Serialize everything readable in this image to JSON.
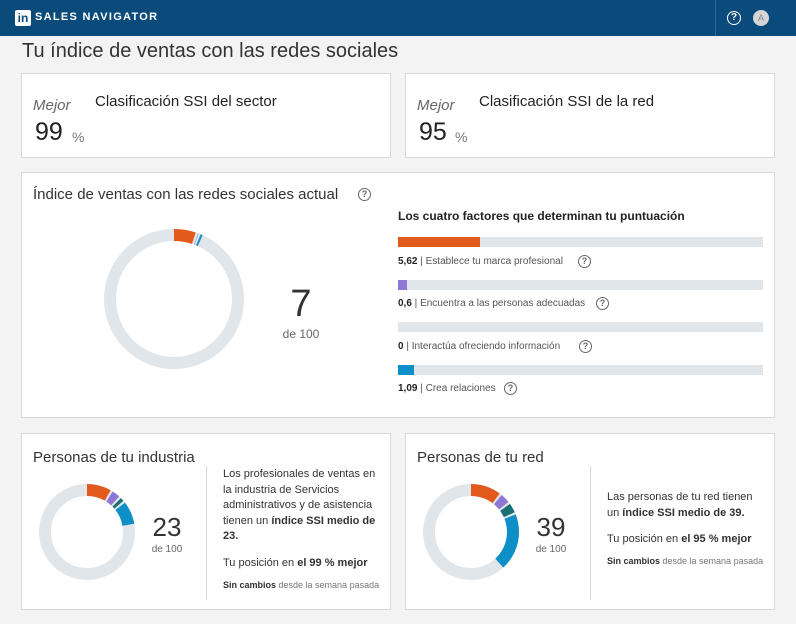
{
  "header": {
    "logo_text": "in",
    "brand": "SALES NAVIGATOR",
    "help_icon": "question-circle-icon",
    "avatar_initial": "A"
  },
  "page_title": "Tu índice de ventas con las redes sociales",
  "rankings": [
    {
      "label": "Mejor",
      "value": "99",
      "unit": "%",
      "title": "Clasificación SSI del sector"
    },
    {
      "label": "Mejor",
      "value": "95",
      "unit": "%",
      "title": "Clasificación SSI de la red"
    }
  ],
  "ssi": {
    "title": "Índice de ventas con las redes sociales actual",
    "score": "7",
    "score_sub": "de 100",
    "factors_title": "Los cuatro factores que determinan tu puntuación",
    "factor_max": 25,
    "factors": [
      {
        "value": "5,62",
        "label": "Establece tu marca profesional",
        "number": 5.62,
        "color": "#e2591c"
      },
      {
        "value": "0,6",
        "label": "Encuentra a las personas adecuadas",
        "number": 0.6,
        "color": "#8f77d6"
      },
      {
        "value": "0",
        "label": "Interactúa ofreciendo información",
        "number": 0,
        "color": "#1b6f73"
      },
      {
        "value": "1,09",
        "label": "Crea relaciones",
        "number": 1.09,
        "color": "#0d8fc7"
      }
    ]
  },
  "groups": [
    {
      "title": "Personas de tu industria",
      "score": "23",
      "score_sub": "de 100",
      "description": "Los profesionales de ventas en la industria de Servicios administrativos y de asistencia tienen un ",
      "description_bold": "índice SSI medio de 23.",
      "position_prefix": "Tu posición en ",
      "position_bold": "el 99 % mejor",
      "change_bold": "Sin cambios",
      "change_rest": " desde la semana pasada",
      "segments": [
        {
          "value": 9,
          "color": "#e2591c"
        },
        {
          "value": 3.5,
          "color": "#8f77d6"
        },
        {
          "value": 2,
          "color": "#1b6f73"
        },
        {
          "value": 8.5,
          "color": "#0d8fc7"
        }
      ]
    },
    {
      "title": "Personas de tu red",
      "score": "39",
      "score_sub": "de 100",
      "description": "Las personas de tu red tienen un ",
      "description_bold": "índice SSI medio de 39.",
      "position_prefix": "Tu posición en ",
      "position_bold": "el 95 % mejor",
      "change_bold": "Sin cambios",
      "change_rest": " desde la semana pasada",
      "segments": [
        {
          "value": 11,
          "color": "#e2591c"
        },
        {
          "value": 4,
          "color": "#8f77d6"
        },
        {
          "value": 4,
          "color": "#1b6f73"
        },
        {
          "value": 20,
          "color": "#0d8fc7"
        }
      ]
    }
  ],
  "colors": {
    "header_bg": "#0a4b7c",
    "track": "#e1e6ea"
  }
}
